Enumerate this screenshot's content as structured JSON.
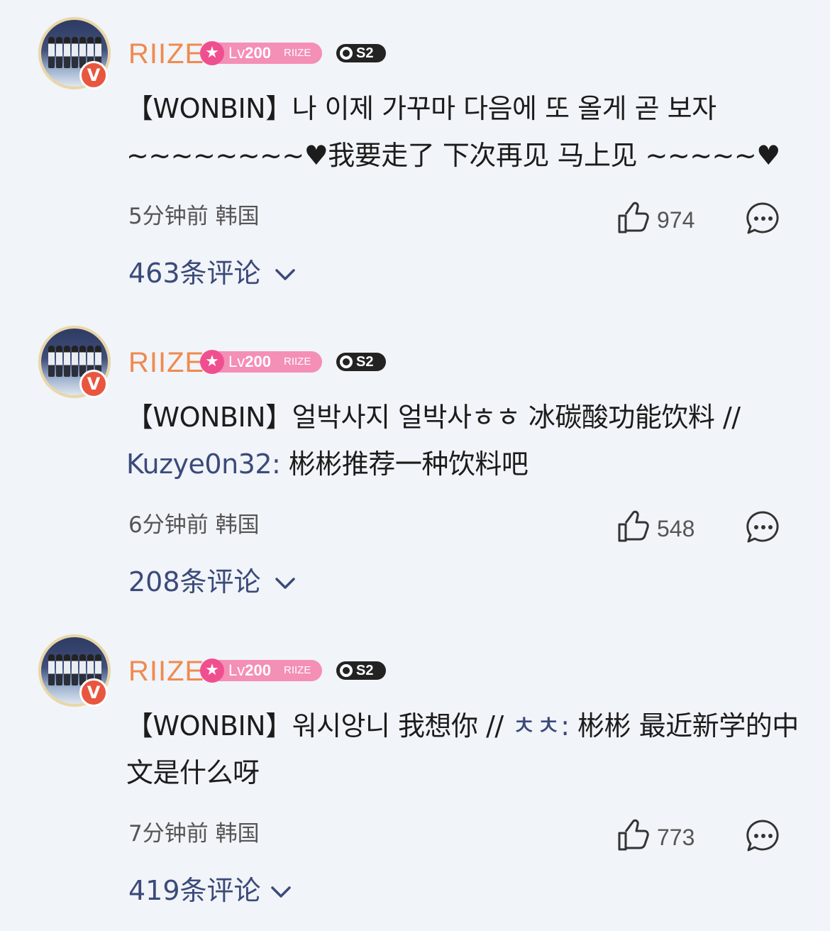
{
  "comments": [
    {
      "avatar_icon": "group-photo-avatar",
      "verified_badge": "V",
      "username": "RIIZE",
      "level_prefix": "Lv",
      "level_number": "200",
      "level_brand": "RIIZE",
      "season_badge": "S2",
      "text_prefix": "【WONBIN】나 이제 가꾸마 다음에 또 올게 곧 보자 ~~~~~~~~♥我要走了 下次再见 马上见 ~~~~~♥",
      "mention": "",
      "text_suffix": "",
      "time": "5分钟前",
      "location": "韩国",
      "likes": "974",
      "replies": "463条评论"
    },
    {
      "avatar_icon": "group-photo-avatar",
      "verified_badge": "V",
      "username": "RIIZE",
      "level_prefix": "Lv",
      "level_number": "200",
      "level_brand": "RIIZE",
      "season_badge": "S2",
      "text_prefix": "【WONBIN】얼박사지 얼박사ㅎㅎ 冰碳酸功能饮料 //",
      "mention": "Kuzye0n32:",
      "text_suffix": " 彬彬推荐一种饮料吧",
      "time": "6分钟前",
      "location": "韩国",
      "likes": "548",
      "replies": "208条评论"
    },
    {
      "avatar_icon": "group-photo-avatar",
      "verified_badge": "V",
      "username": "RIIZE",
      "level_prefix": "Lv",
      "level_number": "200",
      "level_brand": "RIIZE",
      "season_badge": "S2",
      "text_prefix": "【WONBIN】워시앙니 我想你 // ",
      "mention": "ㅊㅊ:",
      "text_suffix": " 彬彬 最近新学的中文是什么呀",
      "time": "7分钟前",
      "location": "韩国",
      "likes": "773",
      "replies": "419条评论"
    }
  ],
  "colors": {
    "background": "#f1f4f8",
    "username": "#ef8a4f",
    "link": "#3b4a7a",
    "level_badge": "#f48fb6",
    "verified": "#e9563f"
  },
  "icons": [
    "thumbs-up-icon",
    "comment-bubble-icon",
    "chevron-down-icon",
    "star-icon"
  ]
}
